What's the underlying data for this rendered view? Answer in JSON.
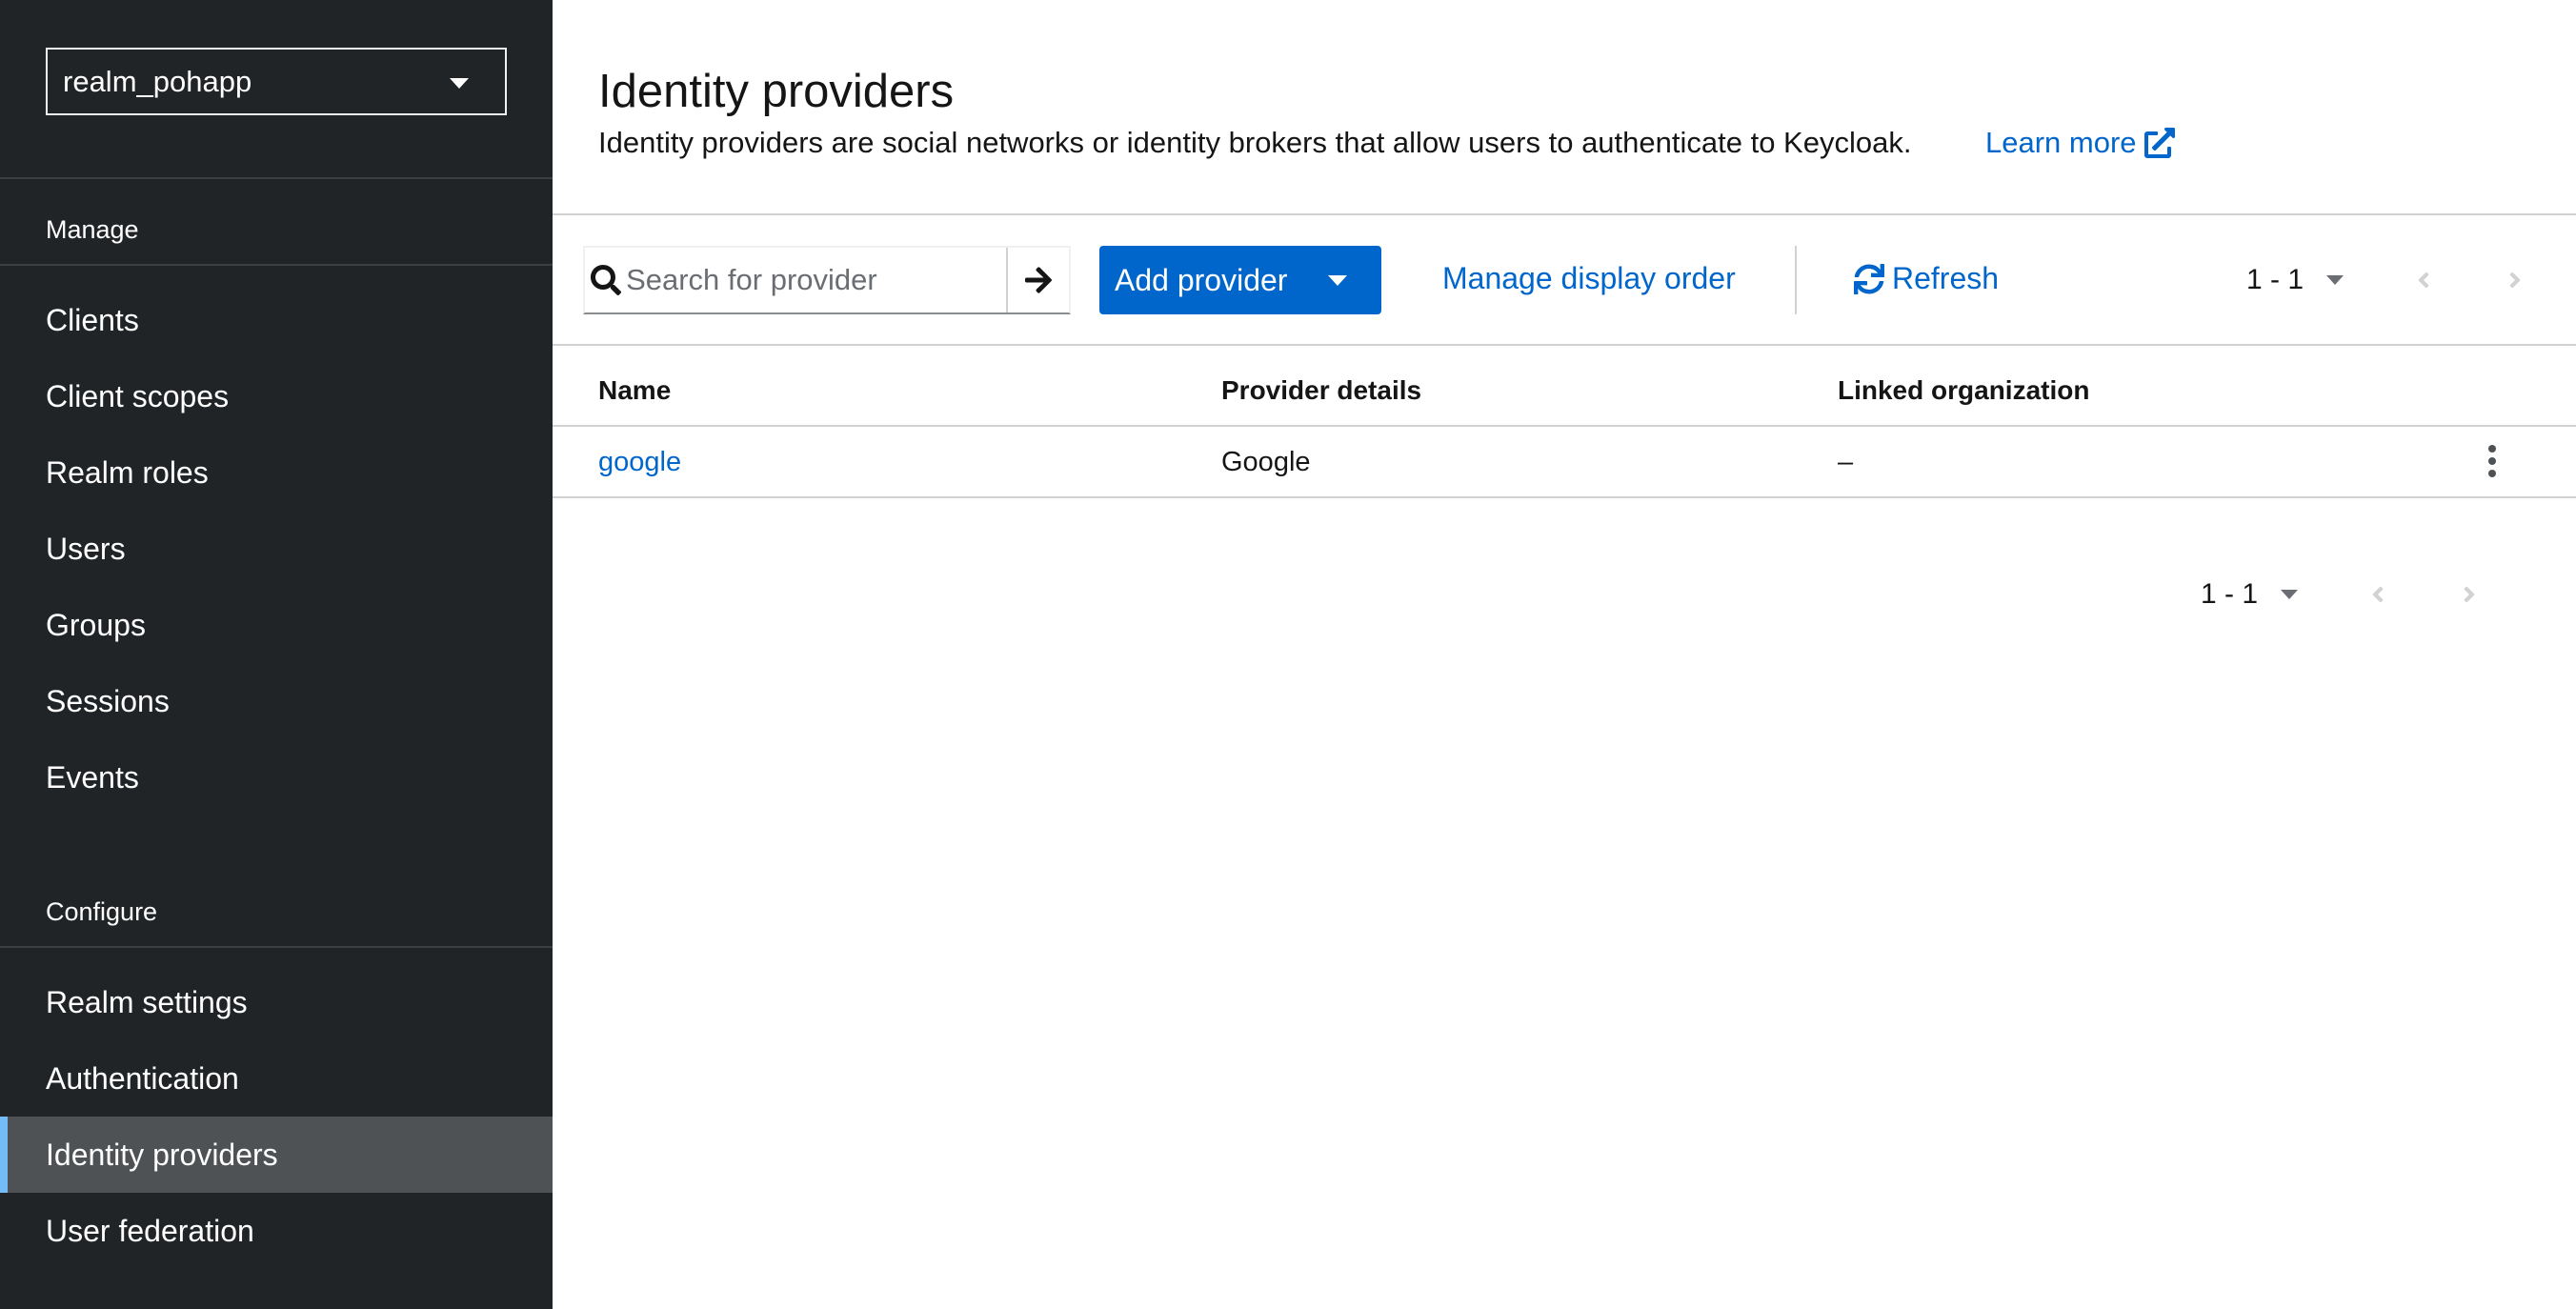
{
  "sidebar": {
    "realm_selector": {
      "value": "realm_pohapp"
    },
    "groups": [
      {
        "label": "Manage"
      },
      {
        "label": "Configure"
      }
    ],
    "manage_items": [
      {
        "label": "Clients"
      },
      {
        "label": "Client scopes"
      },
      {
        "label": "Realm roles"
      },
      {
        "label": "Users"
      },
      {
        "label": "Groups"
      },
      {
        "label": "Sessions"
      },
      {
        "label": "Events"
      }
    ],
    "configure_items": [
      {
        "label": "Realm settings"
      },
      {
        "label": "Authentication"
      },
      {
        "label": "Identity providers",
        "active": true
      },
      {
        "label": "User federation"
      }
    ]
  },
  "header": {
    "title": "Identity providers",
    "description": "Identity providers are social networks or identity brokers that allow users to authenticate to Keycloak.",
    "learn_more": "Learn more"
  },
  "toolbar": {
    "search_placeholder": "Search for provider",
    "search_value": "",
    "add_provider_label": "Add provider",
    "manage_order_label": "Manage display order",
    "refresh_label": "Refresh",
    "pagination_range": "1 - 1"
  },
  "table": {
    "columns": [
      "Name",
      "Provider details",
      "Linked organization"
    ],
    "rows": [
      {
        "name": "google",
        "provider_details": "Google",
        "linked_organization": "–"
      }
    ]
  },
  "footer": {
    "pagination_range": "1 - 1"
  },
  "colors": {
    "sidebar_bg": "#212427",
    "active_item_bg": "#4f5255",
    "active_indicator": "#73bcf7",
    "link": "#0066cc",
    "primary_button": "#0066cc"
  },
  "icons": {
    "realm_caret": "caret-down-icon",
    "search": "search-icon",
    "search_submit": "arrow-right-icon",
    "external_link": "external-link-icon",
    "refresh": "sync-icon",
    "prev": "angle-left-icon",
    "next": "angle-right-icon",
    "row_actions": "kebab-icon"
  }
}
